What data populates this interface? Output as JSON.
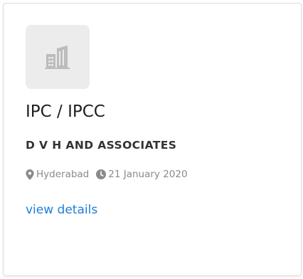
{
  "card": {
    "title": "IPC / IPCC",
    "company": "D V H AND ASSOCIATES",
    "location": "Hyderabad",
    "date": "21 January 2020",
    "link_label": "view details"
  },
  "icons": {
    "logo": "building-icon",
    "location": "map-marker-icon",
    "date": "clock-icon"
  },
  "colors": {
    "link": "#1f7fd4",
    "muted": "#8a8a8a",
    "logo_bg": "#ececec",
    "logo_icon": "#bcbcbc"
  }
}
